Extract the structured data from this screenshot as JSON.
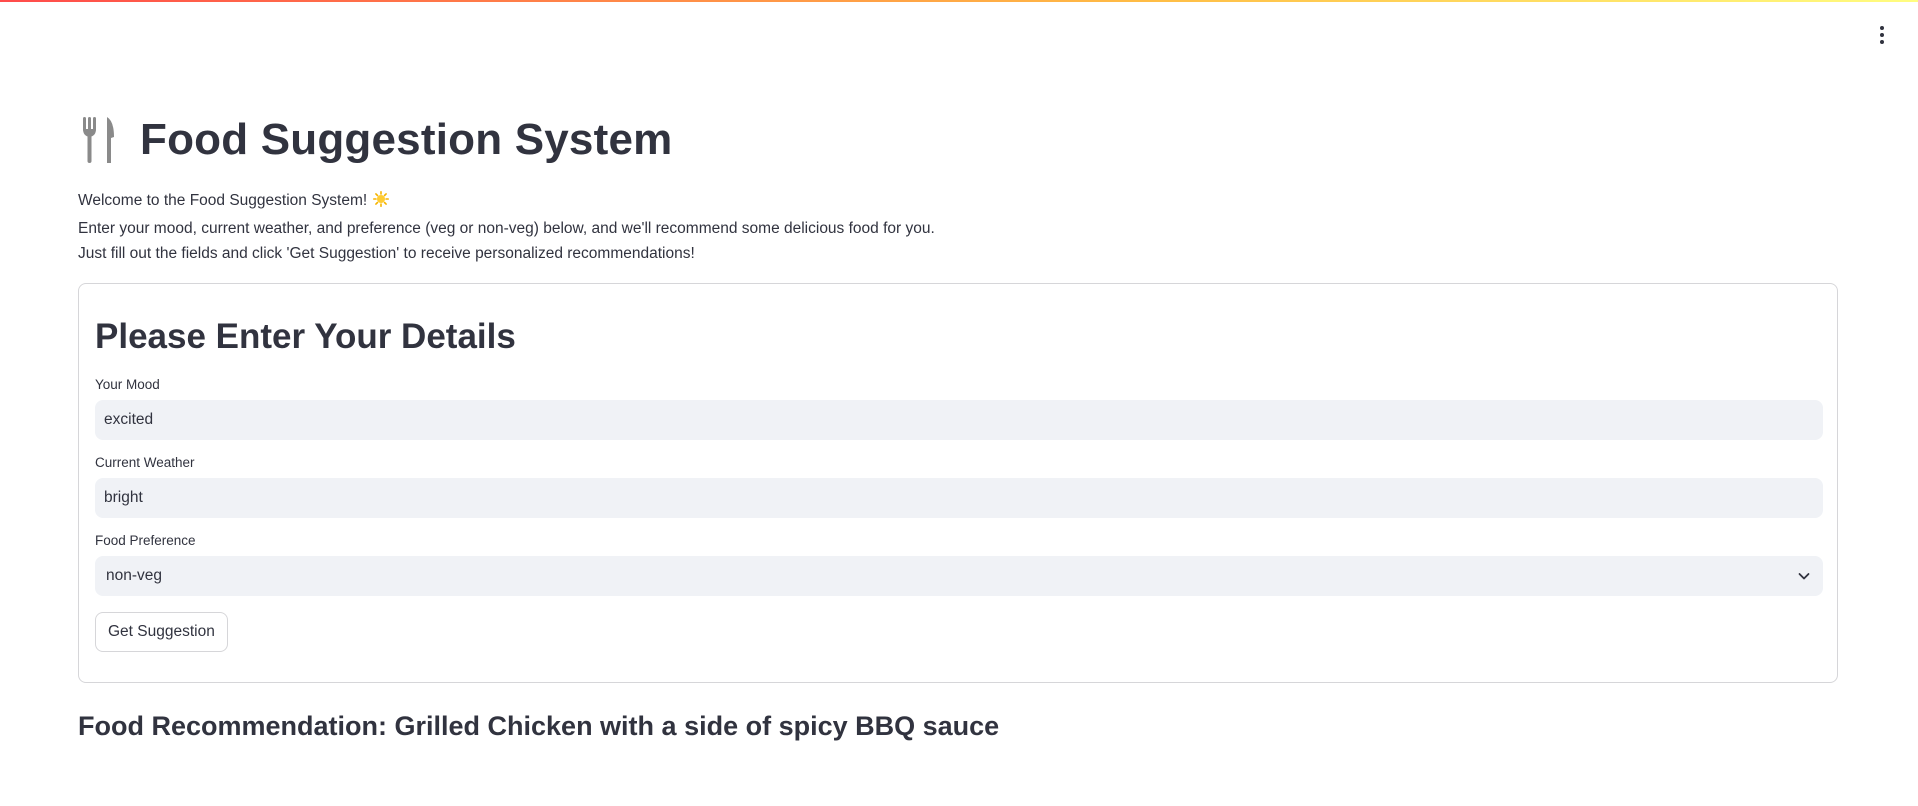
{
  "header": {
    "menu_icon": "vertical-dots-icon",
    "accent_gradient": [
      "#ff4b4b",
      "#ffbd45",
      "#fffd80"
    ]
  },
  "page": {
    "title_icon": "fork-knife-icon",
    "title": "Food Suggestion System",
    "intro_line_1": "Welcome to the Food Suggestion System!",
    "intro_line_1_icon": "sun-icon",
    "intro_line_2": "Enter your mood, current weather, and preference (veg or non-veg) below, and we'll recommend some delicious food for you.",
    "intro_line_3": "Just fill out the fields and click 'Get Suggestion' to receive personalized recommendations!"
  },
  "form": {
    "heading": "Please Enter Your Details",
    "mood": {
      "label": "Your Mood",
      "value": "excited"
    },
    "weather": {
      "label": "Current Weather",
      "value": "bright"
    },
    "preference": {
      "label": "Food Preference",
      "selected": "non-veg"
    },
    "submit_label": "Get Suggestion"
  },
  "result": {
    "text": "Food Recommendation: Grilled Chicken with a side of spicy BBQ sauce"
  },
  "colors": {
    "text": "#31333f",
    "input_bg": "#f0f2f6",
    "border": "#d6d6d9"
  }
}
